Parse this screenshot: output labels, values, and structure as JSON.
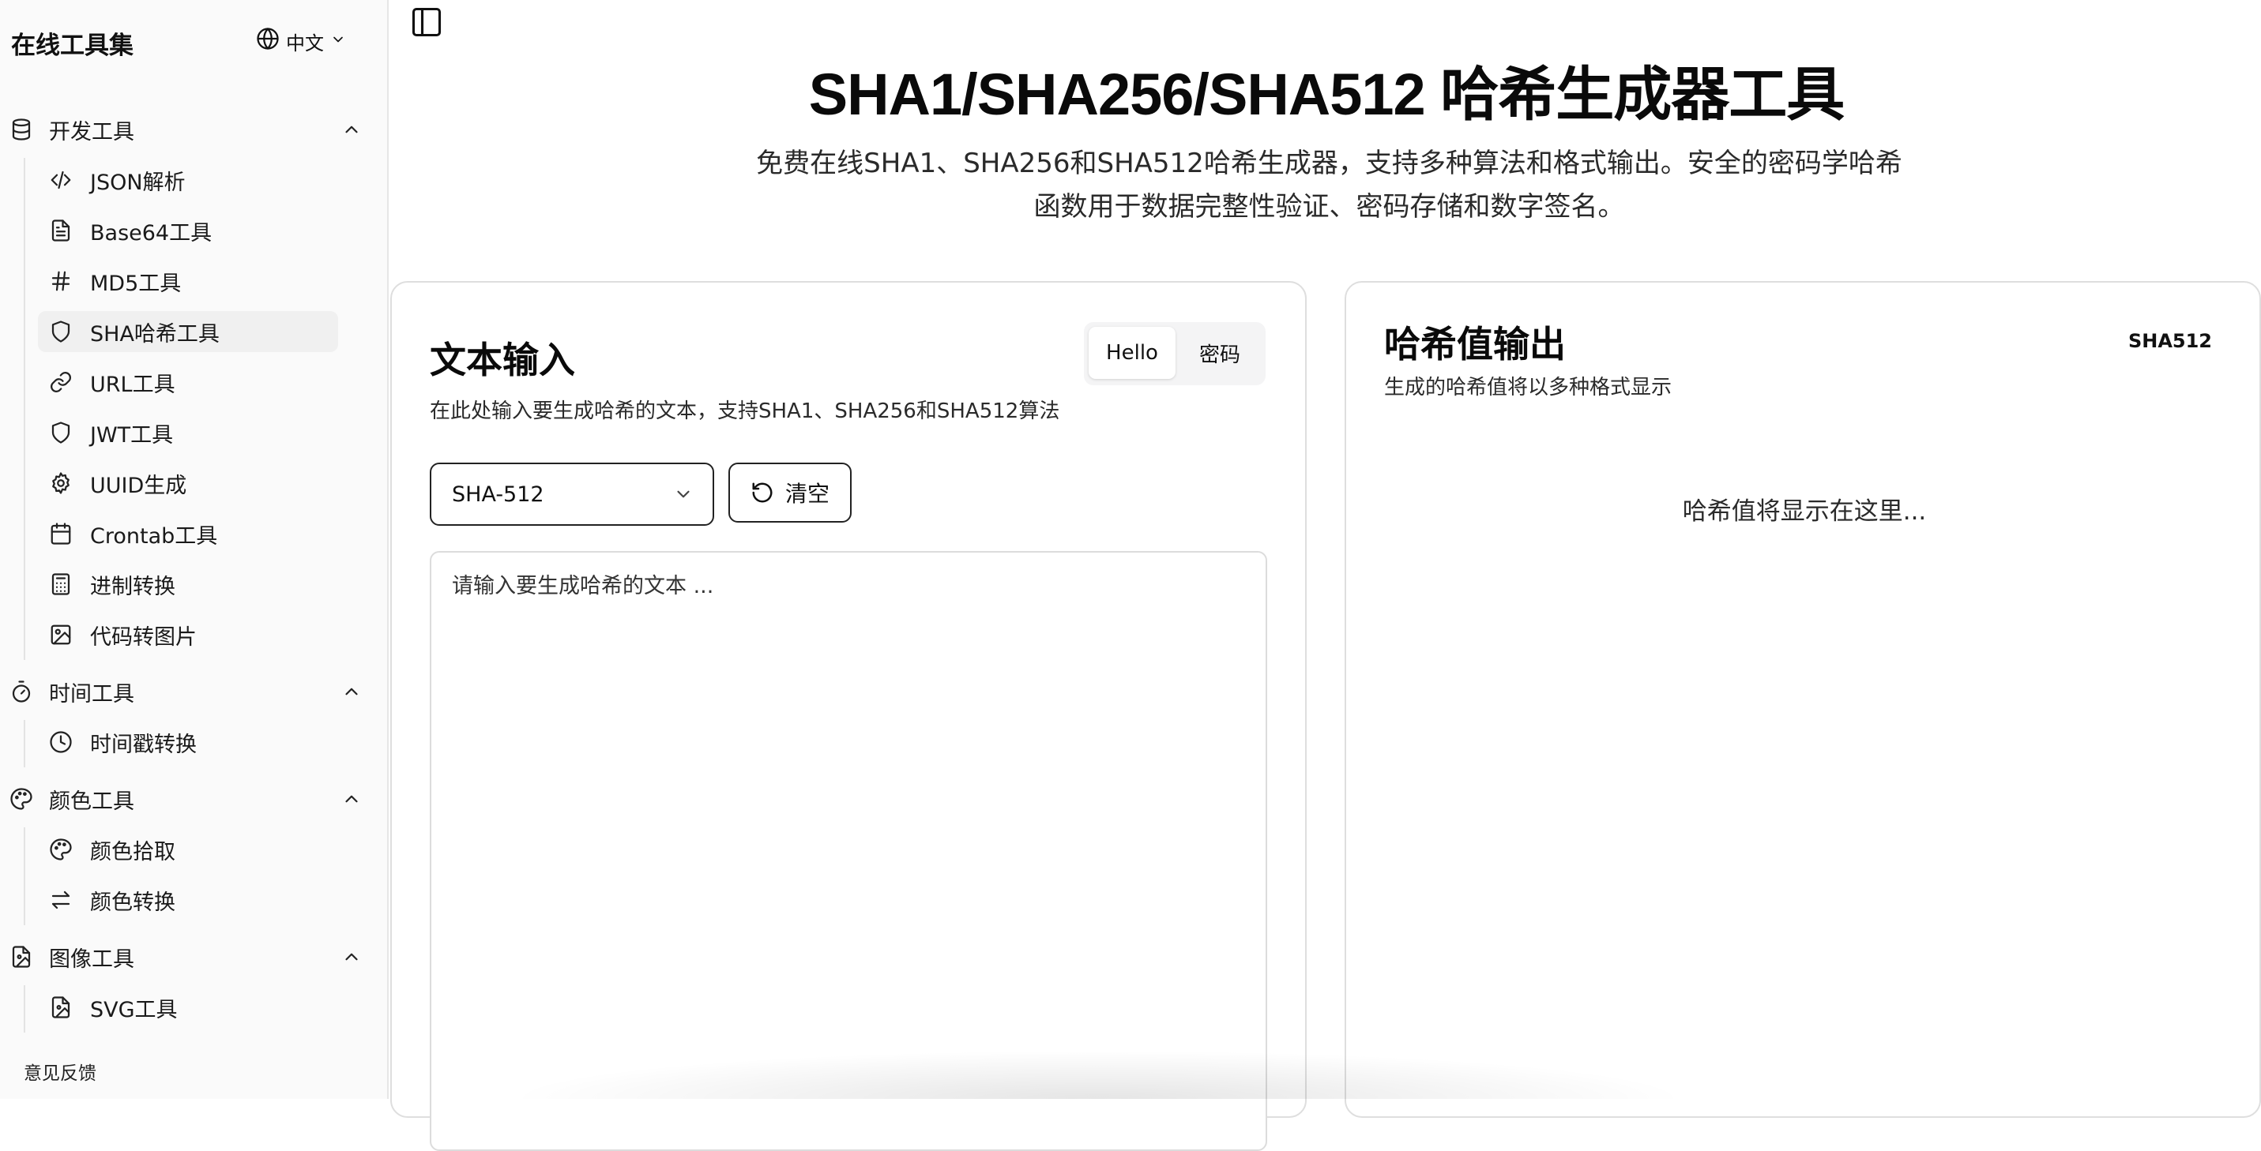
{
  "sidebar": {
    "brand": "在线工具集",
    "language": "中文",
    "groups": [
      {
        "label": "开发工具",
        "icon": "database-icon",
        "items": [
          {
            "label": "JSON解析",
            "icon": "code-icon"
          },
          {
            "label": "Base64工具",
            "icon": "file-text-icon"
          },
          {
            "label": "MD5工具",
            "icon": "hash-icon"
          },
          {
            "label": "SHA哈希工具",
            "icon": "shield-icon",
            "active": true
          },
          {
            "label": "URL工具",
            "icon": "link-icon"
          },
          {
            "label": "JWT工具",
            "icon": "shield-icon"
          },
          {
            "label": "UUID生成",
            "icon": "gear-icon"
          },
          {
            "label": "Crontab工具",
            "icon": "calendar-icon"
          },
          {
            "label": "进制转换",
            "icon": "calculator-icon"
          },
          {
            "label": "代码转图片",
            "icon": "image-icon"
          }
        ]
      },
      {
        "label": "时间工具",
        "icon": "timer-icon",
        "items": [
          {
            "label": "时间戳转换",
            "icon": "clock-icon"
          }
        ]
      },
      {
        "label": "颜色工具",
        "icon": "palette-icon",
        "items": [
          {
            "label": "颜色拾取",
            "icon": "palette-icon"
          },
          {
            "label": "颜色转换",
            "icon": "arrows-swap-icon"
          }
        ]
      },
      {
        "label": "图像工具",
        "icon": "file-image-icon",
        "items": [
          {
            "label": "SVG工具",
            "icon": "file-image-icon"
          }
        ]
      }
    ],
    "feedback": "意见反馈"
  },
  "header": {
    "title": "SHA1/SHA256/SHA512 哈希生成器工具",
    "subtitle_line1": "免费在线SHA1、SHA256和SHA512哈希生成器，支持多种算法和格式输出。安全的密码学哈希",
    "subtitle_line2": "函数用于数据完整性验证、密码存储和数字签名。"
  },
  "input_card": {
    "title": "文本输入",
    "description": "在此处输入要生成哈希的文本，支持SHA1、SHA256和SHA512算法",
    "preset_hello": "Hello",
    "preset_password": "密码",
    "algorithm": "SHA-512",
    "clear_label": "清空",
    "placeholder": "请输入要生成哈希的文本 ..."
  },
  "output_card": {
    "title": "哈希值输出",
    "description": "生成的哈希值将以多种格式显示",
    "badge": "SHA512",
    "placeholder": "哈希值将显示在这里..."
  }
}
